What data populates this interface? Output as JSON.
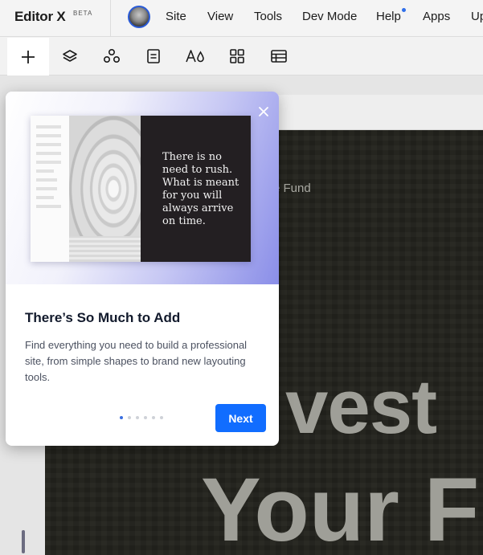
{
  "app": {
    "logo": "Editor X",
    "badge": "BETA"
  },
  "menu": {
    "items": [
      "Site",
      "View",
      "Tools",
      "Dev Mode",
      "Help",
      "Apps",
      "Up"
    ]
  },
  "toolbar": {
    "icons": [
      "add-icon",
      "layers-icon",
      "connections-icon",
      "pages-icon",
      "theme-icon",
      "apps-grid-icon",
      "cms-table-icon"
    ]
  },
  "canvas": {
    "subtitle": "e Fund",
    "headline_1": "vest",
    "headline_2": "Your F"
  },
  "popover": {
    "mock_quote": "There is no need to rush. What is meant for you will always arrive on time.",
    "title": "There’s So Much to Add",
    "description": "Find everything you need to build a professional site, from simple shapes to brand new layouting tools.",
    "next_label": "Next",
    "step_count": 6,
    "active_step": 1
  },
  "colors": {
    "accent": "#116dff",
    "hero_bg": "#23231d"
  }
}
